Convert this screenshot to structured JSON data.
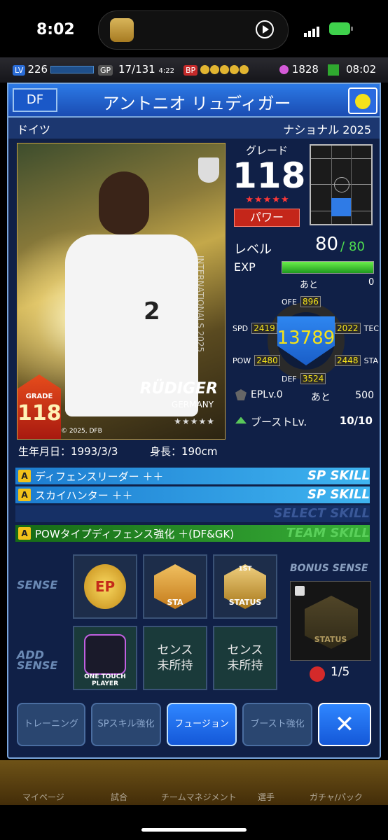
{
  "status_bar": {
    "time": "8:02"
  },
  "game_header": {
    "lv_badge": "LV",
    "level": "226",
    "gp_badge": "GP",
    "stamina": "17/131",
    "stamina_timer": "4:22",
    "bp_badge": "BP",
    "gems": "1828",
    "clock": "08:02"
  },
  "player": {
    "position": "DF",
    "name": "アントニオ リュディガー",
    "country": "ドイツ",
    "series": "ナショナル 2025",
    "card": {
      "card_name": "RÜDIGER",
      "card_country": "GERMANY",
      "grade_tag": "GRADE",
      "grade_value": "118",
      "shirt_number": "2",
      "vertical_text": "INTERNATIONALS 2025",
      "copyright": "© 2025, DFB",
      "stars": "★★★★★"
    },
    "grade_label": "グレード",
    "grade": "118",
    "grade_stars": "★★★★★",
    "type": "パワー",
    "level_label": "レベル",
    "level": "80",
    "level_separator": "/",
    "level_max": "80",
    "exp_label": "EXP",
    "exp_fill": 1.0,
    "exp_remaining_label": "あと",
    "exp_remaining": "0",
    "stats": {
      "total": "13789",
      "ofe_label": "OFE",
      "ofe": "896",
      "def_label": "DEF",
      "def": "3524",
      "spd_label": "SPD",
      "spd": "2419",
      "tec_label": "TEC",
      "tec": "2022",
      "pow_label": "POW",
      "pow": "2480",
      "sta_label": "STA",
      "sta": "2448"
    },
    "epl_label": "EPLv.0",
    "epl_remaining_label": "あと",
    "epl_remaining": "500",
    "boost_label": "ブーストLv.",
    "boost_value": "10/10",
    "dob": "生年月日：1993/3/3",
    "height": "身長：190cm"
  },
  "skills": [
    {
      "name": "ディフェンスリーダー ＋＋",
      "tag": "SP SKILL",
      "icon": "A"
    },
    {
      "name": "スカイハンター ＋＋",
      "tag": "SP SKILL",
      "icon": "A"
    },
    {
      "name": "",
      "tag": "SELECT SKILL",
      "icon": ""
    },
    {
      "name": "POWタイプディフェンス強化 ＋(DF&GK)",
      "tag": "TEAM SKILL",
      "icon": "A"
    }
  ],
  "sense": {
    "sense_label": "SENSE",
    "add_sense_label_1": "ADD",
    "add_sense_label_2": "SENSE",
    "slots": [
      {
        "label": "EP",
        "icon": "ep-medal-icon"
      },
      {
        "label": "STA",
        "icon": "sta-medal-icon"
      },
      {
        "label": "STATUS",
        "badge": "1ST",
        "icon": "status-medal-icon"
      }
    ],
    "add_slots": [
      {
        "label_1": "ONE TOUCH",
        "label_2": "PLAYER",
        "icon": "one-touch-player-icon"
      },
      {
        "label_1": "センス",
        "label_2": "未所持"
      },
      {
        "label_1": "センス",
        "label_2": "未所持"
      }
    ],
    "bonus_label": "BONUS SENSE",
    "bonus_slot_label": "STATUS",
    "bonus_count": "1/5"
  },
  "buttons": {
    "training": "トレーニング",
    "sp_skill": "SPスキル強化",
    "fusion": "フュージョン",
    "boost": "ブースト強化",
    "close": "✕"
  },
  "bottom_nav": [
    "マイページ",
    "試合",
    "チームマネジメント",
    "選手",
    "ガチャ/パック"
  ],
  "colors": {
    "accent": "#2f86ff",
    "sp_skill": "#2fa8e8",
    "team_skill": "#2f9a2f",
    "type_power": "#c4261a",
    "exp_green": "#4fe04f"
  }
}
